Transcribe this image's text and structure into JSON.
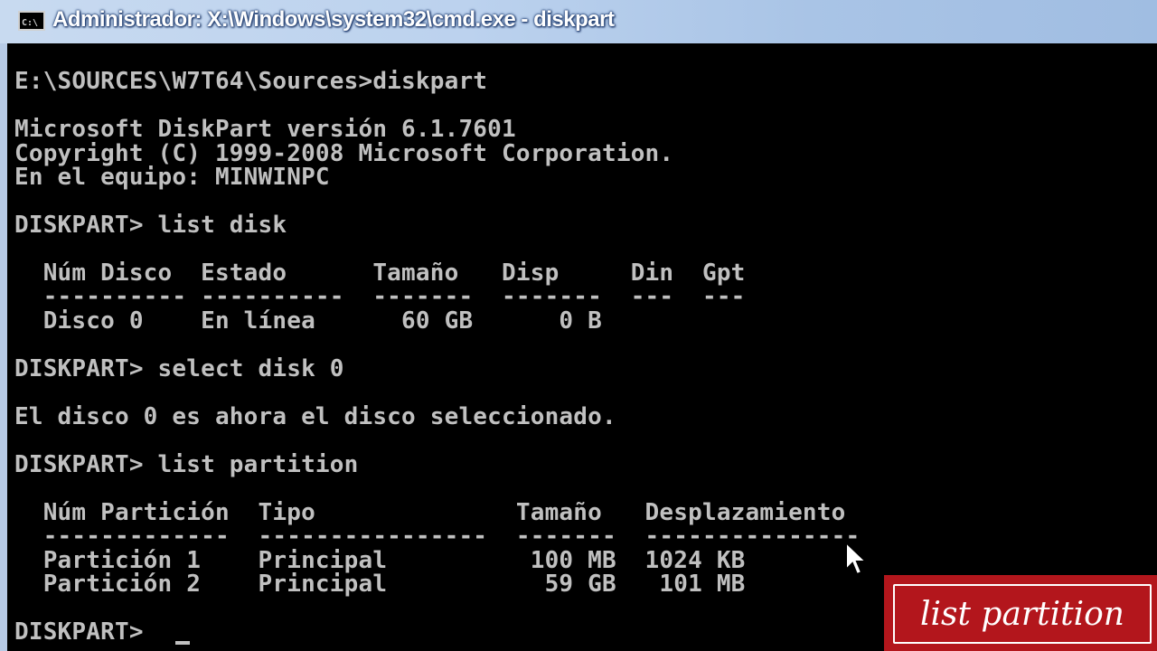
{
  "window": {
    "title": "Administrador: X:\\Windows\\system32\\cmd.exe - diskpart",
    "icon_label": "C:\\",
    "icon": "cmd-icon"
  },
  "console": {
    "lines": [
      "E:\\SOURCES\\W7T64\\Sources>diskpart",
      "Microsoft DiskPart versión 6.1.7601",
      "Copyright (C) 1999-2008 Microsoft Corporation.",
      "En el equipo: MINWINPC",
      "DISKPART> list disk",
      "  Núm Disco  Estado      Tamaño   Disp     Din  Gpt",
      "  ---------- ----------  -------  -------  ---  ---",
      "  Disco 0    En línea      60 GB      0 B",
      "DISKPART> select disk 0",
      "El disco 0 es ahora el disco seleccionado.",
      "DISKPART> list partition",
      "  Núm Partición  Tipo              Tamaño   Desplazamiento",
      "  -------------  ----------------  -------  ---------------",
      "  Partición 1    Principal          100 MB  1024 KB",
      "  Partición 2    Principal           59 GB   101 MB",
      "DISKPART> "
    ]
  },
  "caption": {
    "text": "list partition"
  },
  "colors": {
    "console_bg": "#000000",
    "console_text": "#c0c0c0",
    "caption_bg": "#b3161c"
  }
}
